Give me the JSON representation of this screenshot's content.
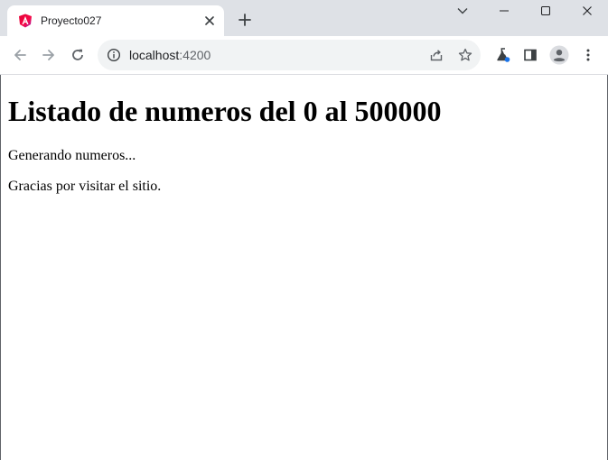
{
  "tab": {
    "title": "Proyecto027"
  },
  "address_bar": {
    "host": "localhost",
    "port": ":4200"
  },
  "page": {
    "heading": "Listado de numeros del 0 al 500000",
    "status_text": "Generando numeros...",
    "footer_text": "Gracias por visitar el sitio."
  },
  "colors": {
    "tab_strip": "#dee1e6",
    "angular_red": "#dd0031",
    "angular_magenta": "#c3002f",
    "labs_blue": "#1a73e8"
  }
}
